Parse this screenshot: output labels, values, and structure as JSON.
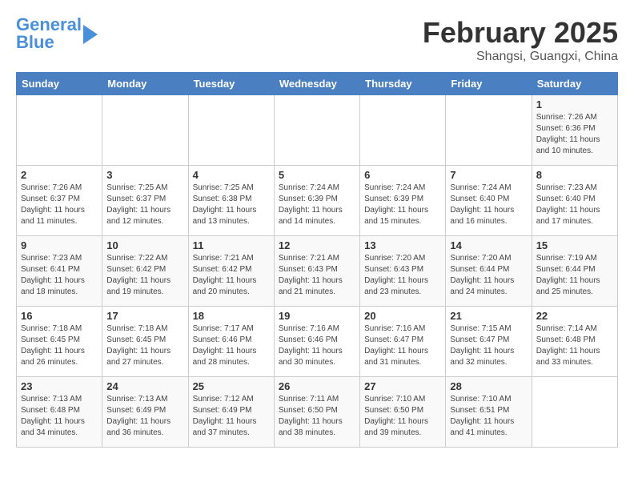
{
  "header": {
    "logo_general": "General",
    "logo_blue": "Blue",
    "month": "February 2025",
    "location": "Shangsi, Guangxi, China"
  },
  "weekdays": [
    "Sunday",
    "Monday",
    "Tuesday",
    "Wednesday",
    "Thursday",
    "Friday",
    "Saturday"
  ],
  "weeks": [
    [
      {
        "day": "",
        "info": ""
      },
      {
        "day": "",
        "info": ""
      },
      {
        "day": "",
        "info": ""
      },
      {
        "day": "",
        "info": ""
      },
      {
        "day": "",
        "info": ""
      },
      {
        "day": "",
        "info": ""
      },
      {
        "day": "1",
        "info": "Sunrise: 7:26 AM\nSunset: 6:36 PM\nDaylight: 11 hours\nand 10 minutes."
      }
    ],
    [
      {
        "day": "2",
        "info": "Sunrise: 7:26 AM\nSunset: 6:37 PM\nDaylight: 11 hours\nand 11 minutes."
      },
      {
        "day": "3",
        "info": "Sunrise: 7:25 AM\nSunset: 6:37 PM\nDaylight: 11 hours\nand 12 minutes."
      },
      {
        "day": "4",
        "info": "Sunrise: 7:25 AM\nSunset: 6:38 PM\nDaylight: 11 hours\nand 13 minutes."
      },
      {
        "day": "5",
        "info": "Sunrise: 7:24 AM\nSunset: 6:39 PM\nDaylight: 11 hours\nand 14 minutes."
      },
      {
        "day": "6",
        "info": "Sunrise: 7:24 AM\nSunset: 6:39 PM\nDaylight: 11 hours\nand 15 minutes."
      },
      {
        "day": "7",
        "info": "Sunrise: 7:24 AM\nSunset: 6:40 PM\nDaylight: 11 hours\nand 16 minutes."
      },
      {
        "day": "8",
        "info": "Sunrise: 7:23 AM\nSunset: 6:40 PM\nDaylight: 11 hours\nand 17 minutes."
      }
    ],
    [
      {
        "day": "9",
        "info": "Sunrise: 7:23 AM\nSunset: 6:41 PM\nDaylight: 11 hours\nand 18 minutes."
      },
      {
        "day": "10",
        "info": "Sunrise: 7:22 AM\nSunset: 6:42 PM\nDaylight: 11 hours\nand 19 minutes."
      },
      {
        "day": "11",
        "info": "Sunrise: 7:21 AM\nSunset: 6:42 PM\nDaylight: 11 hours\nand 20 minutes."
      },
      {
        "day": "12",
        "info": "Sunrise: 7:21 AM\nSunset: 6:43 PM\nDaylight: 11 hours\nand 21 minutes."
      },
      {
        "day": "13",
        "info": "Sunrise: 7:20 AM\nSunset: 6:43 PM\nDaylight: 11 hours\nand 23 minutes."
      },
      {
        "day": "14",
        "info": "Sunrise: 7:20 AM\nSunset: 6:44 PM\nDaylight: 11 hours\nand 24 minutes."
      },
      {
        "day": "15",
        "info": "Sunrise: 7:19 AM\nSunset: 6:44 PM\nDaylight: 11 hours\nand 25 minutes."
      }
    ],
    [
      {
        "day": "16",
        "info": "Sunrise: 7:18 AM\nSunset: 6:45 PM\nDaylight: 11 hours\nand 26 minutes."
      },
      {
        "day": "17",
        "info": "Sunrise: 7:18 AM\nSunset: 6:45 PM\nDaylight: 11 hours\nand 27 minutes."
      },
      {
        "day": "18",
        "info": "Sunrise: 7:17 AM\nSunset: 6:46 PM\nDaylight: 11 hours\nand 28 minutes."
      },
      {
        "day": "19",
        "info": "Sunrise: 7:16 AM\nSunset: 6:46 PM\nDaylight: 11 hours\nand 30 minutes."
      },
      {
        "day": "20",
        "info": "Sunrise: 7:16 AM\nSunset: 6:47 PM\nDaylight: 11 hours\nand 31 minutes."
      },
      {
        "day": "21",
        "info": "Sunrise: 7:15 AM\nSunset: 6:47 PM\nDaylight: 11 hours\nand 32 minutes."
      },
      {
        "day": "22",
        "info": "Sunrise: 7:14 AM\nSunset: 6:48 PM\nDaylight: 11 hours\nand 33 minutes."
      }
    ],
    [
      {
        "day": "23",
        "info": "Sunrise: 7:13 AM\nSunset: 6:48 PM\nDaylight: 11 hours\nand 34 minutes."
      },
      {
        "day": "24",
        "info": "Sunrise: 7:13 AM\nSunset: 6:49 PM\nDaylight: 11 hours\nand 36 minutes."
      },
      {
        "day": "25",
        "info": "Sunrise: 7:12 AM\nSunset: 6:49 PM\nDaylight: 11 hours\nand 37 minutes."
      },
      {
        "day": "26",
        "info": "Sunrise: 7:11 AM\nSunset: 6:50 PM\nDaylight: 11 hours\nand 38 minutes."
      },
      {
        "day": "27",
        "info": "Sunrise: 7:10 AM\nSunset: 6:50 PM\nDaylight: 11 hours\nand 39 minutes."
      },
      {
        "day": "28",
        "info": "Sunrise: 7:10 AM\nSunset: 6:51 PM\nDaylight: 11 hours\nand 41 minutes."
      },
      {
        "day": "",
        "info": ""
      }
    ]
  ]
}
